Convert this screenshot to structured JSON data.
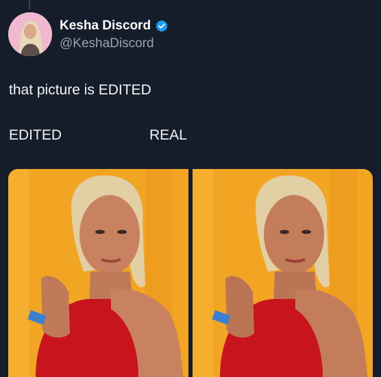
{
  "author": {
    "display_name": "Kesha Discord",
    "handle": "@KeshaDiscord",
    "verified": true,
    "avatar_icon": "avatar-photo"
  },
  "tweet": {
    "text": "that picture is EDITED"
  },
  "comparison": {
    "left_label": "EDITED",
    "right_label": "REAL"
  },
  "colors": {
    "background": "#141d29",
    "verified_badge": "#1d9bf0",
    "photo_backdrop": "#f2a423",
    "top_red": "#c8141c"
  },
  "media": {
    "images": [
      {
        "name": "edited-photo",
        "description_icon": "portrait-photo"
      },
      {
        "name": "real-photo",
        "description_icon": "portrait-photo"
      }
    ]
  }
}
